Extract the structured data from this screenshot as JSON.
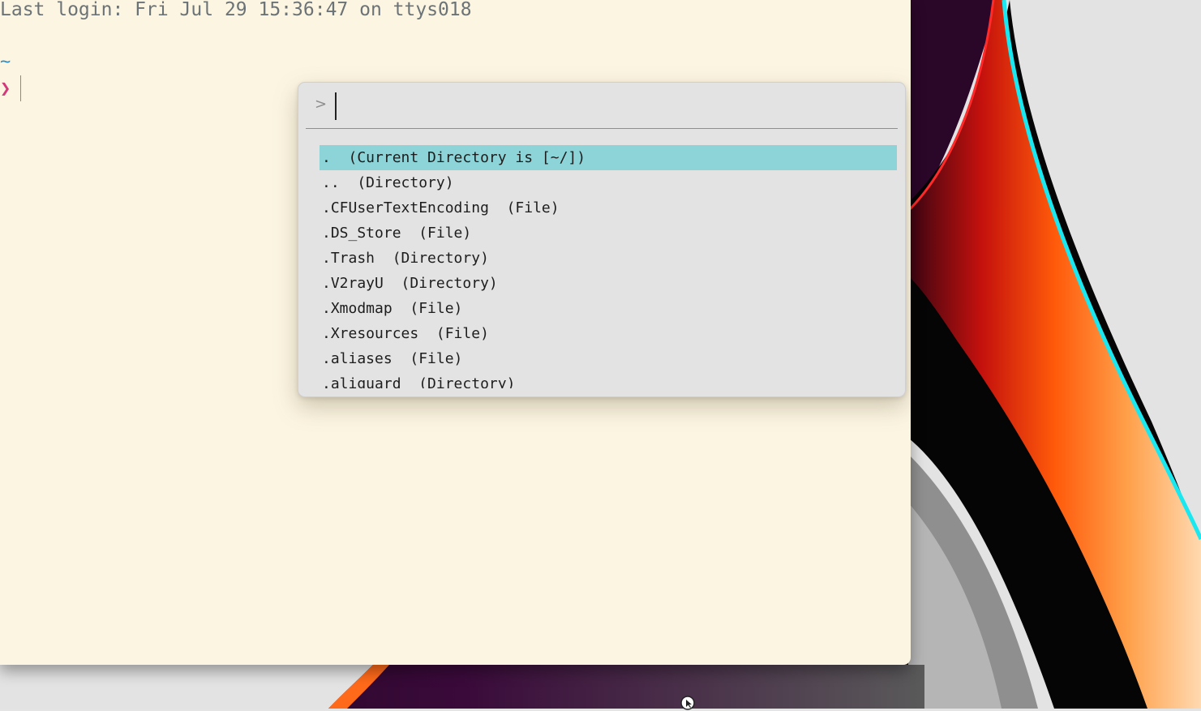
{
  "terminal": {
    "login_line": "Last login: Fri Jul 29 15:36:47 on ttys018",
    "cwd": "~",
    "prompt_symbol": "❯"
  },
  "finder": {
    "prompt_icon": "chevron-right-icon",
    "prompt_symbol": ">",
    "query": "",
    "items": [
      {
        "label": ".  (Current Directory is [~/])"
      },
      {
        "label": "..  (Directory)"
      },
      {
        "label": ".CFUserTextEncoding  (File)"
      },
      {
        "label": ".DS_Store  (File)"
      },
      {
        "label": ".Trash  (Directory)"
      },
      {
        "label": ".V2rayU  (Directory)"
      },
      {
        "label": ".Xmodmap  (File)"
      },
      {
        "label": ".Xresources  (File)"
      },
      {
        "label": ".aliases  (File)"
      },
      {
        "label": ".aliguard  (Directory)"
      }
    ]
  },
  "colors": {
    "terminal_bg": "#fcf5e2",
    "finder_bg": "#e3e3e3",
    "selection": "#8dd4d8",
    "prompt_magenta": "#d3397a",
    "cwd_blue": "#2f8fc4"
  }
}
